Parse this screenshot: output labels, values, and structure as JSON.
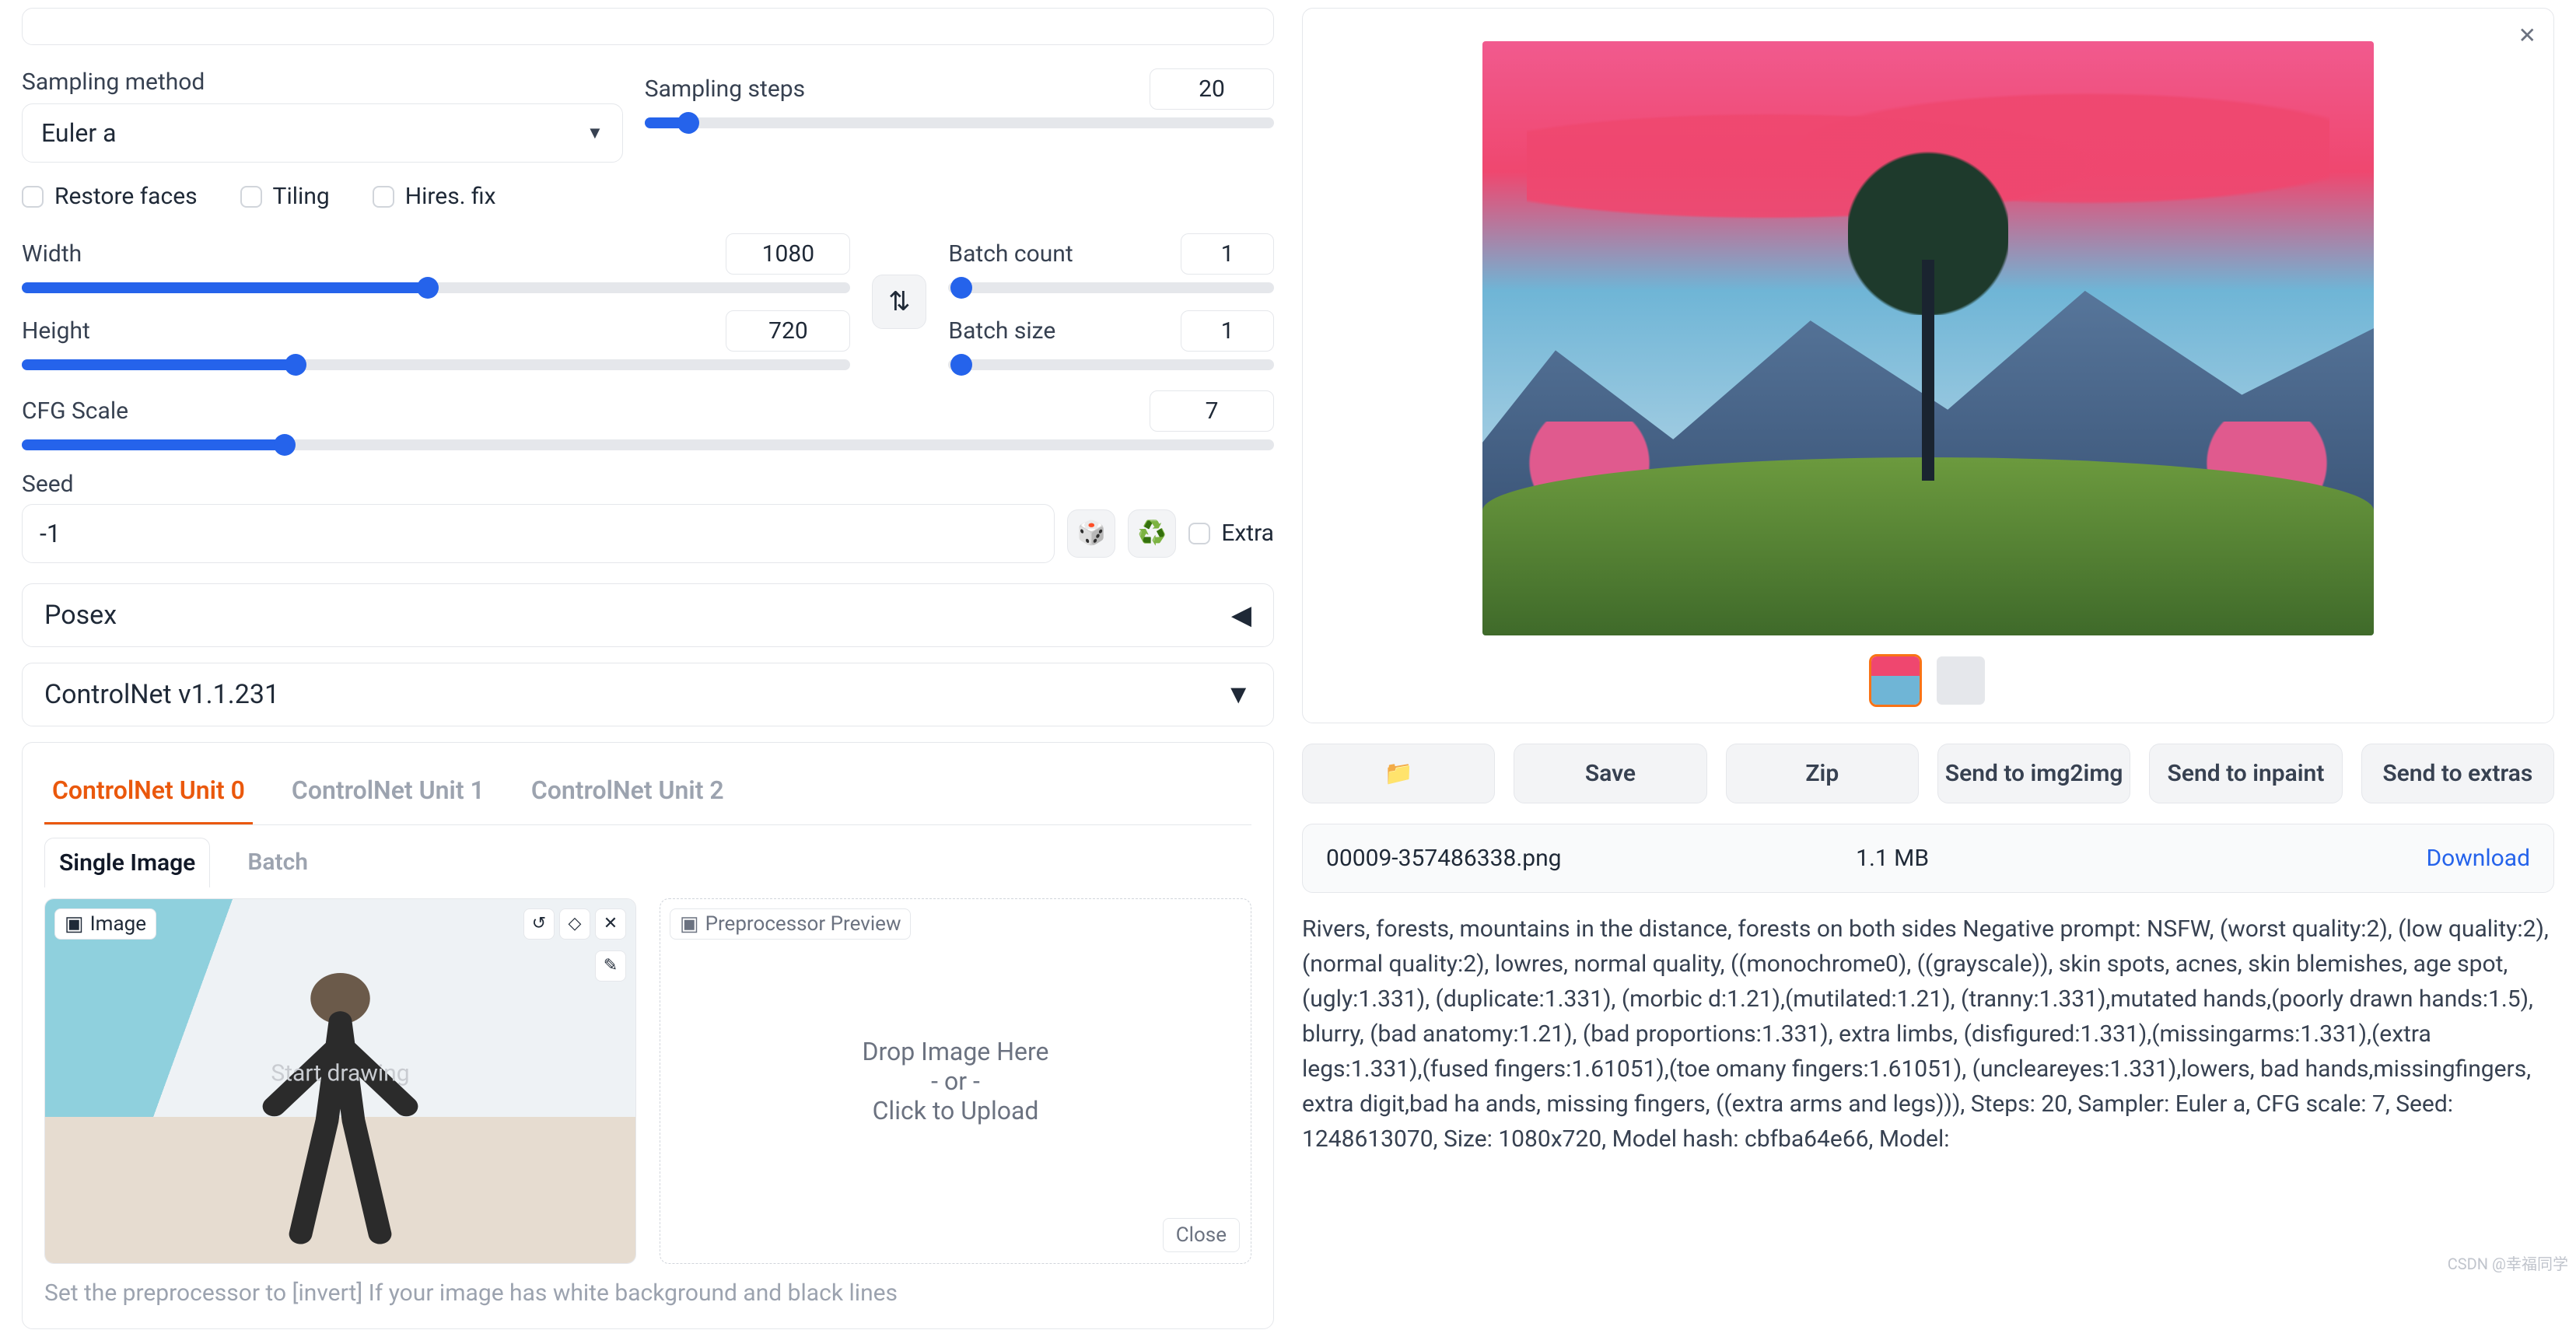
{
  "sampling": {
    "method_label": "Sampling method",
    "method_value": "Euler a",
    "steps_label": "Sampling steps",
    "steps_value": "20",
    "steps_pct": 7
  },
  "checks": {
    "restore": "Restore faces",
    "tiling": "Tiling",
    "hires": "Hires. fix"
  },
  "dims": {
    "width_label": "Width",
    "width_value": "1080",
    "width_pct": 49,
    "height_label": "Height",
    "height_value": "720",
    "height_pct": 33
  },
  "batch": {
    "count_label": "Batch count",
    "count_value": "1",
    "count_pct": 0,
    "size_label": "Batch size",
    "size_value": "1",
    "size_pct": 0
  },
  "cfg": {
    "label": "CFG Scale",
    "value": "7",
    "pct": 21
  },
  "seed": {
    "label": "Seed",
    "value": "-1",
    "extra_label": "Extra"
  },
  "accordions": {
    "posex": "Posex",
    "controlnet": "ControlNet v1.1.231"
  },
  "cn_tabs": {
    "u0": "ControlNet Unit 0",
    "u1": "ControlNet Unit 1",
    "u2": "ControlNet Unit 2"
  },
  "cn_subtabs": {
    "single": "Single Image",
    "batch": "Batch"
  },
  "cn_image": {
    "tag": "Image",
    "overlay": "Start drawing",
    "preview_tag": "Preprocessor Preview",
    "drop1": "Drop Image Here",
    "drop2": "- or -",
    "drop3": "Click to Upload",
    "close": "Close"
  },
  "bottom_hint": "Set the preprocessor to [invert] If your image has white background and black lines",
  "buttons": {
    "folder": "📁",
    "save": "Save",
    "zip": "Zip",
    "img2img": "Send to img2img",
    "inpaint": "Send to inpaint",
    "extras": "Send to extras"
  },
  "file": {
    "name": "00009-357486338.png",
    "size": "1.1 MB",
    "download": "Download"
  },
  "metadata": "Rivers, forests, mountains in the distance, forests on both sides\nNegative prompt: NSFW, (worst quality:2), (low quality:2), (normal quality:2), lowres, normal quality, ((monochrome0), ((grayscale)), skin spots, acnes, skin blemishes, age spot, (ugly:1.331), (duplicate:1.331), (morbic d:1.21),(mutilated:1.21), (tranny:1.331),mutated hands,(poorly drawn hands:1.5), blurry, (bad anatomy:1.21), (bad proportions:1.331), extra limbs, (disfigured:1.331),(missingarms:1.331),(extra legs:1.331),(fused fingers:1.61051),(toe omany fingers:1.61051), (uncleareyes:1.331),lowers, bad hands,missingfingers, extra digit,bad ha ands, missing fingers, ((extra arms and legs))),\nSteps: 20, Sampler: Euler a, CFG scale: 7, Seed: 1248613070, Size: 1080x720, Model hash: cbfba64e66, Model:",
  "watermark": "CSDN @幸福同学"
}
